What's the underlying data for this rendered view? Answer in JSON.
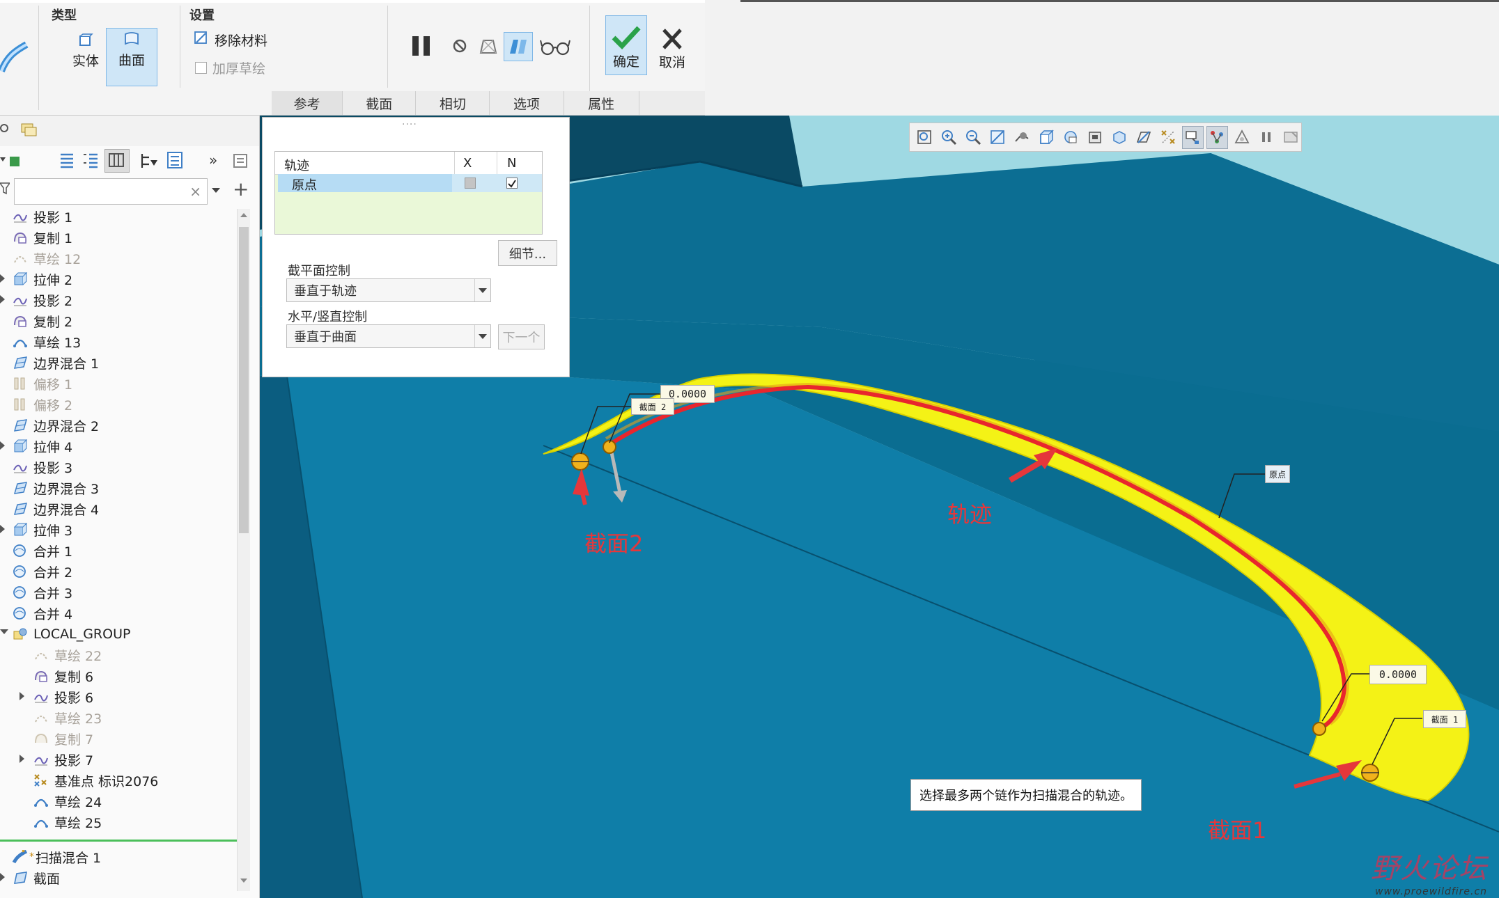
{
  "ribbon": {
    "type_group": {
      "label": "类型",
      "solid": "实体",
      "surface": "曲面"
    },
    "settings_group": {
      "label": "设置",
      "remove_material": "移除材料",
      "thicken_sketch": "加厚草绘"
    },
    "ok": "确定",
    "cancel": "取消",
    "tabs": [
      "参考",
      "截面",
      "相切",
      "选项",
      "属性"
    ]
  },
  "ref_panel": {
    "grip": "····",
    "table_headers": [
      "轨迹",
      "X",
      "N"
    ],
    "row": {
      "name": "原点",
      "x_checked": false,
      "n_checked": true
    },
    "detail_button": "细节...",
    "section_plane_label": "截平面控制",
    "section_plane_value": "垂直于轨迹",
    "hv_control_label": "水平/竖直控制",
    "hv_control_value": "垂直于曲面",
    "next_button": "下一个"
  },
  "tree": {
    "items": [
      {
        "label": "投影 1",
        "icon": "projection-icon",
        "dim": false
      },
      {
        "label": "复制 1",
        "icon": "copy-icon",
        "dim": false
      },
      {
        "label": "草绘 12",
        "icon": "sketch-icon",
        "dim": true
      },
      {
        "label": "拉伸 2",
        "icon": "extrude-icon",
        "dim": false
      },
      {
        "label": "投影 2",
        "icon": "projection-icon",
        "dim": false
      },
      {
        "label": "复制 2",
        "icon": "copy-icon",
        "dim": false
      },
      {
        "label": "草绘 13",
        "icon": "sketch-icon",
        "dim": false
      },
      {
        "label": "边界混合 1",
        "icon": "boundary-blend-icon",
        "dim": false
      },
      {
        "label": "偏移 1",
        "icon": "offset-icon",
        "dim": true
      },
      {
        "label": "偏移 2",
        "icon": "offset-icon",
        "dim": true
      },
      {
        "label": "边界混合 2",
        "icon": "boundary-blend-icon",
        "dim": false
      },
      {
        "label": "拉伸 4",
        "icon": "extrude-icon",
        "dim": false
      },
      {
        "label": "投影 3",
        "icon": "projection-icon",
        "dim": false
      },
      {
        "label": "边界混合 3",
        "icon": "boundary-blend-icon",
        "dim": false
      },
      {
        "label": "边界混合 4",
        "icon": "boundary-blend-icon",
        "dim": false
      },
      {
        "label": "拉伸 3",
        "icon": "extrude-icon",
        "dim": false
      },
      {
        "label": "合并 1",
        "icon": "merge-icon",
        "dim": false
      },
      {
        "label": "合并 2",
        "icon": "merge-icon",
        "dim": false
      },
      {
        "label": "合并 3",
        "icon": "merge-icon",
        "dim": false
      },
      {
        "label": "合并 4",
        "icon": "merge-icon",
        "dim": false
      },
      {
        "label": "LOCAL_GROUP",
        "icon": "group-icon",
        "dim": false
      },
      {
        "label": "草绘 22",
        "icon": "sketch-icon",
        "dim": true
      },
      {
        "label": "复制 6",
        "icon": "copy-icon",
        "dim": false
      },
      {
        "label": "投影 6",
        "icon": "projection-icon",
        "dim": false
      },
      {
        "label": "草绘 23",
        "icon": "sketch-icon",
        "dim": true
      },
      {
        "label": "复制 7",
        "icon": "copy-icon",
        "dim": true
      },
      {
        "label": "投影 7",
        "icon": "projection-icon",
        "dim": false
      },
      {
        "label": "基准点 标识2076",
        "icon": "datum-point-icon",
        "dim": false
      },
      {
        "label": "草绘 24",
        "icon": "sketch-icon",
        "dim": false
      },
      {
        "label": "草绘 25",
        "icon": "sketch-icon",
        "dim": false
      }
    ],
    "active_feature": "扫描混合 1",
    "active_sub": "截面"
  },
  "viewport": {
    "tag_value_1": "0.0000",
    "tag_section_2": "截面 2",
    "tag_origin": "原点",
    "tag_value_2": "0.0000",
    "tag_section_1": "截面 1",
    "annotation_section2": "截面2",
    "annotation_trajectory": "轨迹",
    "annotation_section1": "截面1",
    "status_tip": "选择最多两个链作为扫描混合的轨迹。",
    "watermark_cn": "野火论坛",
    "watermark_url": "www.proewildfire.cn"
  },
  "colors": {
    "model_blue": "#0f7ea8",
    "sky": "#9fd9e3",
    "surface_yellow": "#f4f216",
    "trajectory_red": "#e8262d",
    "ok_green": "#2aa24a"
  }
}
